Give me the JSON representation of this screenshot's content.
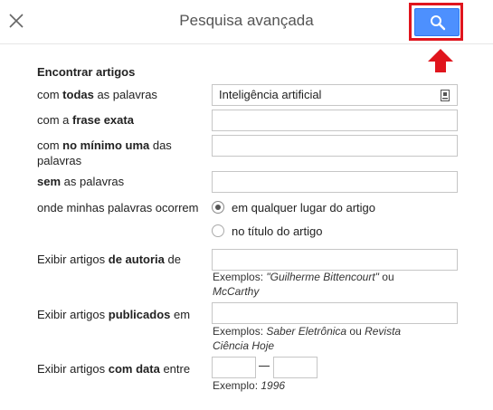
{
  "header": {
    "title": "Pesquisa avançada"
  },
  "section": {
    "find_articles": "Encontrar artigos"
  },
  "fields": {
    "all_words": {
      "pre": "com ",
      "bold": "todas",
      "post": " as palavras",
      "value": "Inteligência artificial"
    },
    "exact_phrase": {
      "pre": "com a ",
      "bold": "frase exata",
      "post": ""
    },
    "at_least_one": {
      "pre": "com ",
      "bold": "no mínimo uma",
      "post": " das palavras"
    },
    "without": {
      "pre": "",
      "bold": "sem",
      "post": " as palavras"
    },
    "where_occur": {
      "label": "onde minhas palavras ocorrem"
    },
    "author": {
      "pre": "Exibir artigos ",
      "bold": "de autoria",
      "post": " de"
    },
    "published_in": {
      "pre": "Exibir artigos ",
      "bold": "publicados",
      "post": " em"
    },
    "date_between": {
      "pre": "Exibir artigos ",
      "bold": "com data",
      "post": " entre"
    }
  },
  "radios": [
    {
      "label": "em qualquer lugar do artigo",
      "checked": true
    },
    {
      "label": "no título do artigo",
      "checked": false
    }
  ],
  "hints": {
    "author": {
      "prefix": "Exemplos: ",
      "ex1": "\"Guilherme Bittencourt\"",
      "mid": " ou",
      "ex2": "McCarthy"
    },
    "published": {
      "prefix": "Exemplos: ",
      "ex1": "Saber Eletrônica",
      "mid": " ou ",
      "ex2a": "Revista",
      "ex2b": "Ciência Hoje"
    },
    "date": {
      "prefix": "Exemplo: ",
      "ex": "1996"
    }
  },
  "icons": {
    "close": "close-icon",
    "search": "search-icon",
    "keyboard": "keyboard-icon",
    "arrow": "arrow-up-icon"
  },
  "colors": {
    "search_button": "#4d90fe",
    "highlight": "#e0151d"
  }
}
